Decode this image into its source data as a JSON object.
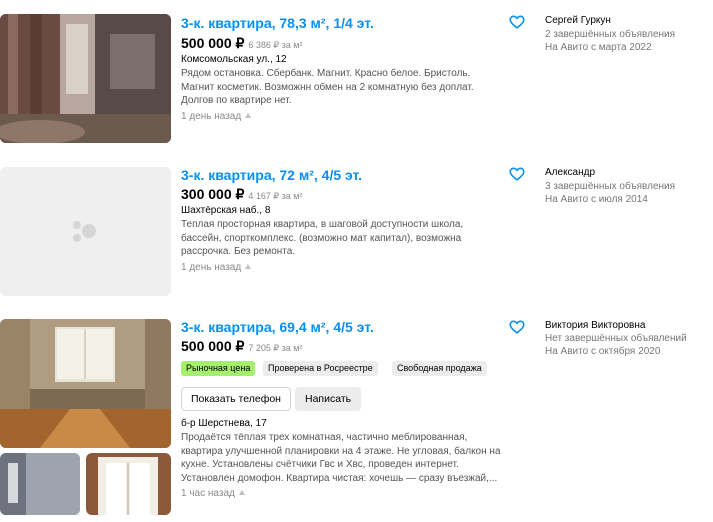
{
  "listings": [
    {
      "title": "3-к. квартира, 78,3 м², 1/4 эт.",
      "price": "500 000 ₽",
      "price_per_m2": "6 386 ₽ за м²",
      "address": "Комсомольская ул., 12",
      "description_lines": [
        "Рядом остановка. Сбербанк. Магнит. Красно белое. Бристоль.",
        "Магнит косметик. Возможнн обмен на 2 комнатную без доплат.",
        "Долгов по квартире нет."
      ],
      "date": "1 день назад",
      "seller": {
        "name": "Сергей Гуркун",
        "completed": "2 завершённых объявления",
        "since": "На Авито с марта 2022"
      }
    },
    {
      "title": "3-к. квартира, 72 м², 4/5 эт.",
      "price": "300 000 ₽",
      "price_per_m2": "4 167 ₽ за м²",
      "address": "Шахтёрская наб., 8",
      "description_lines": [
        "Теплая просторная квартира, в шаговой доступности школа,",
        "бассейн, спорткомплекс. (возможно мат капитал), возможна",
        "рассрочка. Без ремонта."
      ],
      "date": "1 день назад",
      "seller": {
        "name": "Александр",
        "completed": "3 завершённых объявления",
        "since": "На Авито с июля 2014"
      }
    },
    {
      "title": "3-к. квартира, 69,4 м², 4/5 эт.",
      "price": "500 000 ₽",
      "price_per_m2": "7 205 ₽ за м²",
      "badges": [
        "Рыночная цена",
        "Проверена в Росреестре",
        "Свободная продажа"
      ],
      "buttons": {
        "show_phone": "Показать телефон",
        "write": "Написать"
      },
      "address": "б-р Шерстнева, 17",
      "description_lines": [
        "Продаётся тёплая трех комнатная, частично меблированная,",
        "квартира улучшенной планировки на 4 этаже. Не угловая, балкон на",
        "кухне. Установлены счётчики Гвс и Хвс, проведен интернет.",
        "Установлен домофон. Квартира чистая: хочешь — сразу въезжай,..."
      ],
      "date": "1 час назад",
      "seller": {
        "name": "Виктория Викторовна",
        "completed": "Нет завершённых объявлений",
        "since": "На Авито с октября 2020"
      }
    }
  ],
  "colors": {
    "title": "#0a8ff0",
    "badge_market_bg": "#a6ee6e",
    "badge_neutral_bg": "#ececec",
    "heart": "#0a8ff0",
    "placeholder_bg": "#efefef"
  },
  "icons": {
    "favorite": "heart-outline-icon",
    "raise": "up-arrow-icon",
    "no_photo": "photo-placeholder-icon"
  }
}
